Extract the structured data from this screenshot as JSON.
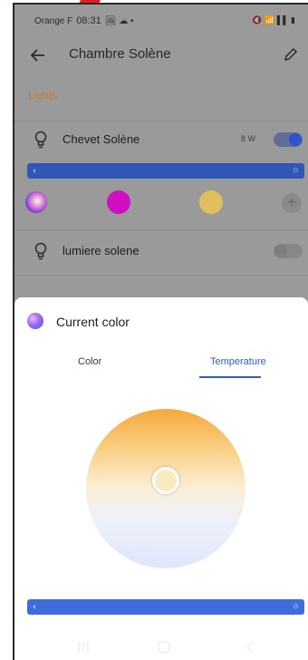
{
  "status_bar": {
    "carrier": "Orange F",
    "time": "08:31",
    "misc_icons": "🖼 ☁ •",
    "right_icons": "🔇 📶 ▌▌ ▮"
  },
  "header": {
    "title": "Chambre Solène"
  },
  "section_title": "Lights",
  "lights": [
    {
      "name": "Chevet Solène",
      "power": "8 W",
      "on": true
    },
    {
      "name": "lumiere solene",
      "on": false
    }
  ],
  "swatch_colors": [
    "#d010c0",
    "#e2bf5e"
  ],
  "add_label": "+",
  "sheet": {
    "title": "Current color",
    "tabs": [
      {
        "label": "Color",
        "active": false
      },
      {
        "label": "Temperature",
        "active": true
      }
    ]
  },
  "slider_icons": {
    "left": "◐",
    "right": "☼"
  },
  "colors": {
    "accent": "#2b5fd9",
    "section": "#c87a2a"
  }
}
